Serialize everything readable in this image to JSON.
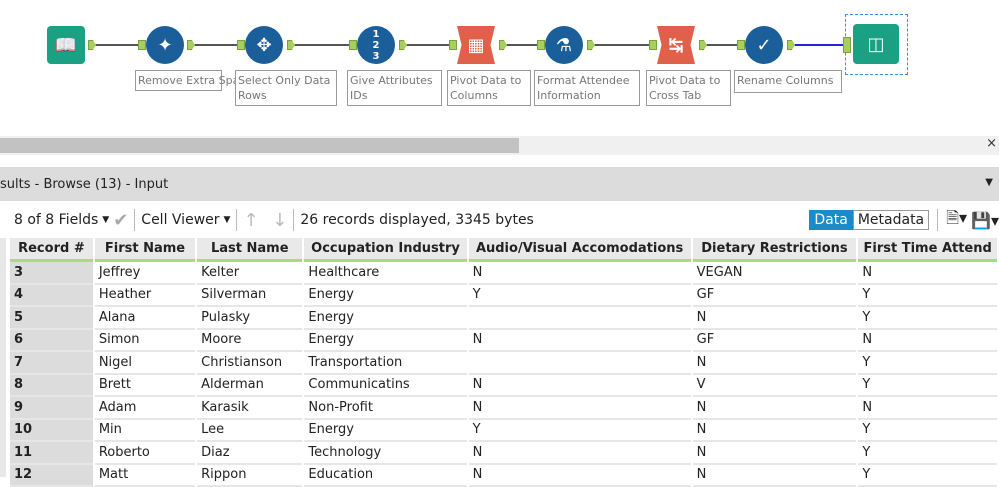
{
  "workflow": {
    "tools": [
      {
        "name": "input",
        "label": ""
      },
      {
        "name": "data-cleansing",
        "label": "Remove Extra Spaces"
      },
      {
        "name": "select",
        "label": "Select Only Data Rows"
      },
      {
        "name": "record-id",
        "label": "Give Attributes IDs"
      },
      {
        "name": "transpose",
        "label": "Pivot Data to Columns"
      },
      {
        "name": "formula",
        "label": "Format Attendee Information"
      },
      {
        "name": "cross-tab",
        "label": "Pivot Data to Cross Tab"
      },
      {
        "name": "dynamic-rename",
        "label": "Rename Columns"
      },
      {
        "name": "browse",
        "label": ""
      }
    ]
  },
  "results": {
    "title": "sults - Browse (13) - Input"
  },
  "toolbar": {
    "fields": "8 of 8 Fields",
    "cell_viewer": "Cell Viewer",
    "status": "26 records displayed, 3345 bytes",
    "data": "Data",
    "metadata": "Metadata"
  },
  "table": {
    "headers": [
      "Record #",
      "First Name",
      "Last Name",
      "Occupation Industry",
      "Audio/Visual Accomodations",
      "Dietary Restrictions",
      "First Time Attend"
    ],
    "rows": [
      [
        "3",
        "Jeffrey",
        "Kelter",
        "Healthcare",
        "N",
        "VEGAN",
        "N"
      ],
      [
        "4",
        "Heather",
        "Silverman",
        "Energy",
        "Y",
        "GF",
        "Y"
      ],
      [
        "5",
        "Alana",
        "Pulasky",
        "Energy",
        "",
        "N",
        "Y"
      ],
      [
        "6",
        "Simon",
        "Moore",
        "Energy",
        "N",
        "GF",
        "N"
      ],
      [
        "7",
        "Nigel",
        "Christianson",
        "Transportation",
        "",
        "N",
        "Y"
      ],
      [
        "8",
        "Brett",
        "Alderman",
        "Communicatins",
        "N",
        "V",
        "Y"
      ],
      [
        "9",
        "Adam",
        "Karasik",
        "Non-Profit",
        "N",
        "N",
        "N"
      ],
      [
        "10",
        "Min",
        "Lee",
        "Energy",
        "Y",
        "N",
        "Y"
      ],
      [
        "11",
        "Roberto",
        "Diaz",
        "Technology",
        "N",
        "N",
        "Y"
      ],
      [
        "12",
        "Matt",
        "Rippon",
        "Education",
        "N",
        "N",
        "Y"
      ]
    ]
  }
}
